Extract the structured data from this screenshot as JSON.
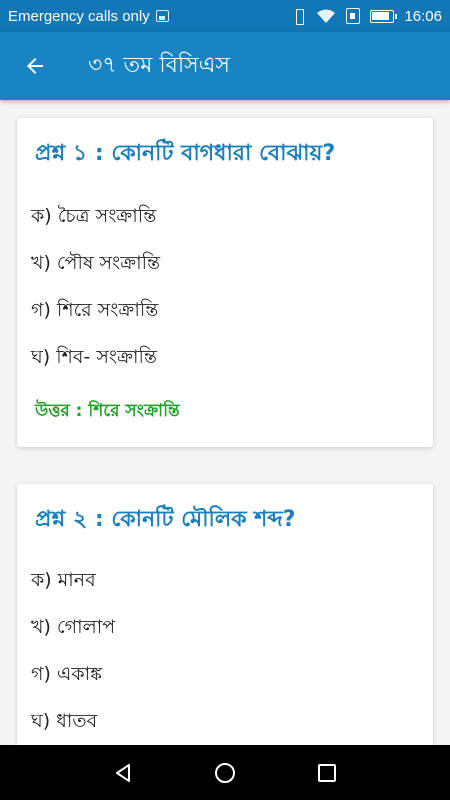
{
  "status_bar": {
    "carrier_text": "Emergency calls only",
    "time": "16:06",
    "icons": [
      "image-notification-icon",
      "vibrate-icon",
      "wifi-icon",
      "sim-icon",
      "battery-icon"
    ]
  },
  "app_bar": {
    "title": "৩৭ তম বিসিএস",
    "back_icon": "arrow-back-icon"
  },
  "questions": [
    {
      "question": "প্রশ্ন ১ : কোনটি বাগধারা বোঝায়?",
      "options": [
        "ক) চৈত্র সংক্রান্তি",
        "খ) পৌষ সংক্রান্তি",
        "গ) শিরে সংক্রান্তি",
        "ঘ) শিব- সংক্রান্তি"
      ],
      "answer": "উত্তর : শিরে সংক্রান্তি"
    },
    {
      "question": "প্রশ্ন ২ : কোনটি মৌলিক শব্দ?",
      "options": [
        "ক) মানব",
        "খ) গোলাপ",
        "গ) একাঙ্ক",
        "ঘ) ধাতব"
      ]
    }
  ],
  "nav_bar": {
    "icons": [
      "back-triangle-icon",
      "home-circle-icon",
      "recents-square-icon"
    ]
  },
  "colors": {
    "status_bar": "#1277b6",
    "app_bar": "#1984c4",
    "question_text": "#1a7fbe",
    "answer_text": "#1ea126"
  }
}
